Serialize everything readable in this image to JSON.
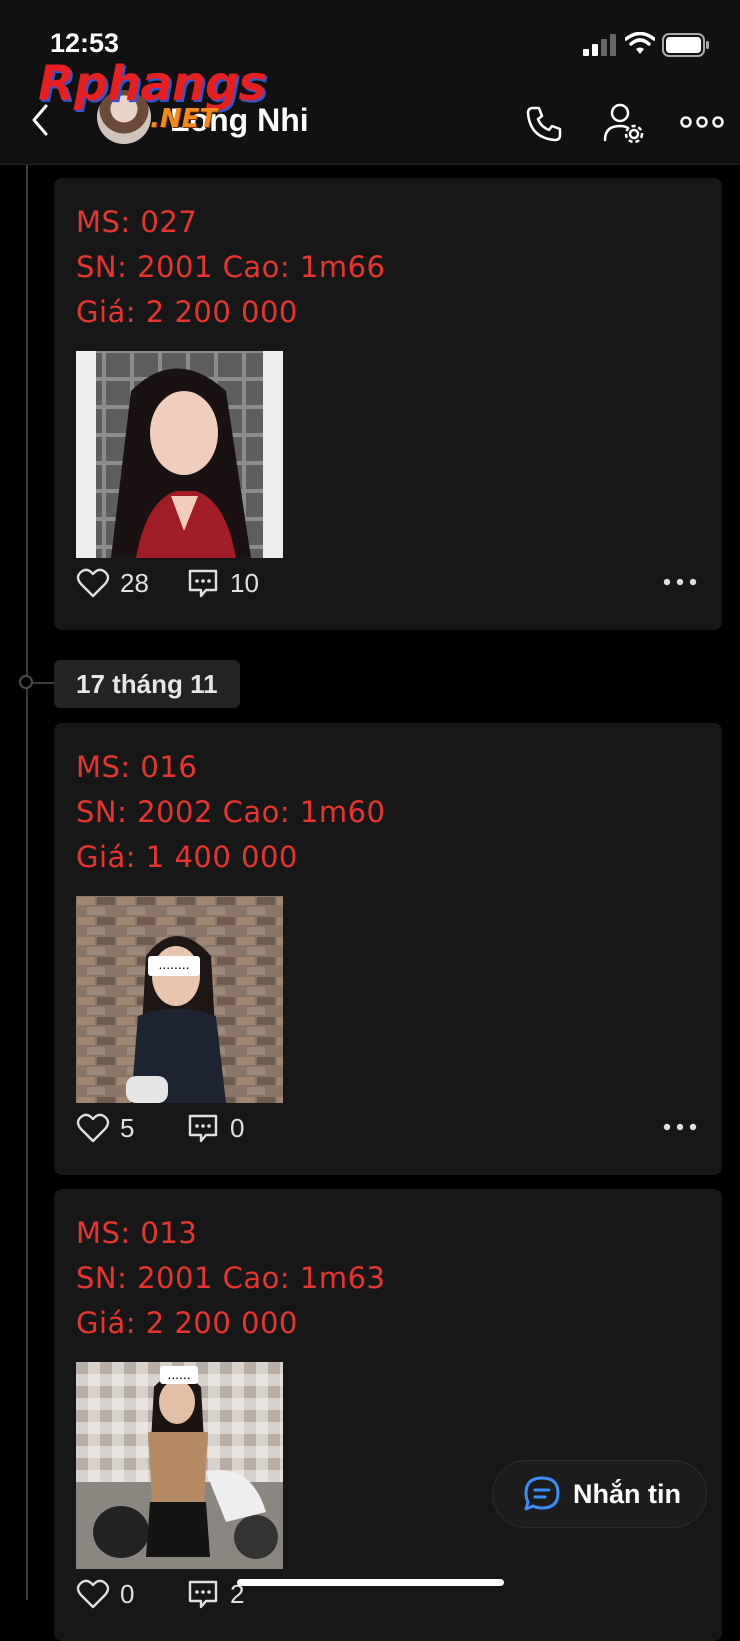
{
  "status_bar": {
    "time": "12:53"
  },
  "header": {
    "contact_name": "Long Nhi",
    "watermark_main": "Rphangs",
    "watermark_sub": ".NET"
  },
  "timeline": {
    "date_label": "17 tháng 11"
  },
  "posts": [
    {
      "code": "MS: 027",
      "info": "SN: 2001 Cao: 1m66",
      "price": "Giá: 2 200 000",
      "likes": "28",
      "comments": "10",
      "photo_label": ""
    },
    {
      "code": "MS: 016",
      "info": "SN: 2002 Cao: 1m60",
      "price": "Giá: 1 400 000",
      "likes": "5",
      "comments": "0",
      "photo_label": "........"
    },
    {
      "code": "MS: 013",
      "info": "SN: 2001 Cao: 1m63",
      "price": "Giá: 2 200 000",
      "likes": "0",
      "comments": "2",
      "photo_label": "......"
    }
  ],
  "fab": {
    "label": "Nhắn tin"
  },
  "colors": {
    "accent_red": "#e6352f",
    "background": "#000000",
    "card": "#171717",
    "fab_icon": "#3b8cf5"
  },
  "icons": [
    "back-icon",
    "phone-icon",
    "user-settings-icon",
    "more-icon",
    "heart-icon",
    "comment-icon",
    "chat-icon"
  ]
}
